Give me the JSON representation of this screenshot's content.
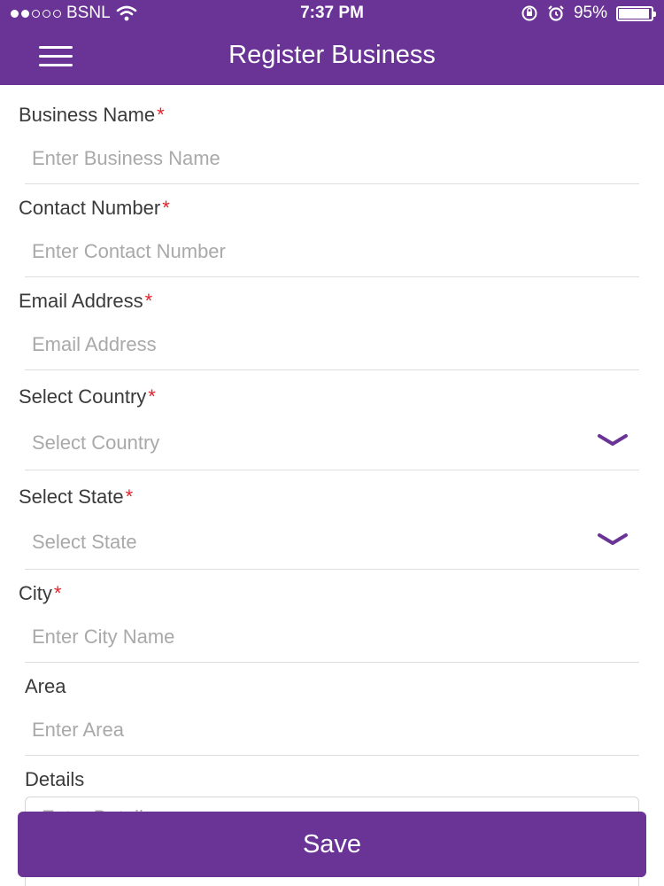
{
  "status_bar": {
    "carrier": "BSNL",
    "time": "7:37 PM",
    "battery": "95%",
    "signal_bars_filled": 2,
    "signal_bars_total": 5,
    "battery_level": 0.95
  },
  "nav": {
    "title": "Register Business",
    "menu_icon": "hamburger-menu-icon"
  },
  "form": {
    "required_mark": "*",
    "business_name": {
      "label": "Business Name",
      "placeholder": "Enter Business Name"
    },
    "contact_number": {
      "label": "Contact Number",
      "placeholder": "Enter Contact Number"
    },
    "email": {
      "label": "Email Address",
      "placeholder": "Email Address"
    },
    "country": {
      "label": "Select Country",
      "placeholder": "Select Country",
      "icon": "chevron-down-icon"
    },
    "state": {
      "label": "Select State",
      "placeholder": "Select State",
      "icon": "chevron-down-icon"
    },
    "city": {
      "label": "City",
      "placeholder": "Enter City Name"
    },
    "area": {
      "label": "Area",
      "placeholder": "Enter Area"
    },
    "details": {
      "label": "Details",
      "placeholder": "Enter Details"
    }
  },
  "actions": {
    "save_label": "Save"
  },
  "colors": {
    "brand": "#6a3497",
    "required": "#e0242b",
    "placeholder": "#a9a9a9"
  }
}
